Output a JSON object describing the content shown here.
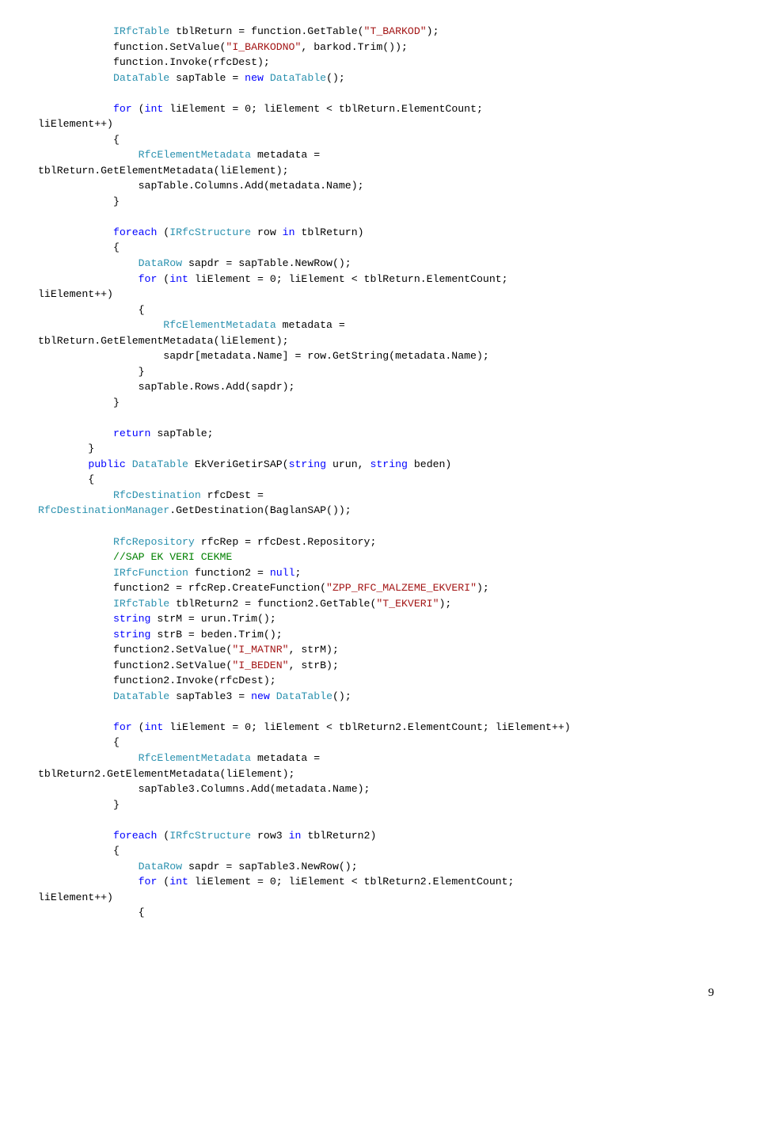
{
  "page_number": "9",
  "tokens": {
    "kw_for": "for",
    "kw_int": "int",
    "kw_new": "new",
    "kw_foreach": "foreach",
    "kw_in": "in",
    "kw_return": "return",
    "kw_public": "public",
    "kw_string": "string",
    "kw_null": "null",
    "type_IRfcTable": "IRfcTable",
    "type_DataTable": "DataTable",
    "type_RfcElementMetadata": "RfcElementMetadata",
    "type_IRfcStructure": "IRfcStructure",
    "type_DataRow": "DataRow",
    "type_RfcDestination": "RfcDestination",
    "type_RfcDestinationManager": "RfcDestinationManager",
    "type_RfcRepository": "RfcRepository",
    "type_IRfcFunction": "IRfcFunction",
    "str_T_BARKOD": "\"T_BARKOD\"",
    "str_I_BARKODNO": "\"I_BARKODNO\"",
    "str_ZPP": "\"ZPP_RFC_MALZEME_EKVERI\"",
    "str_T_EKVERI": "\"T_EKVERI\"",
    "str_I_MATNR": "\"I_MATNR\"",
    "str_I_BEDEN": "\"I_BEDEN\"",
    "com_sap": "//SAP EK VERI CEKME",
    "txt_line1": " tblReturn = function.GetTable(",
    "txt_line1b": ");",
    "txt_line2": "            function.SetValue(",
    "txt_line2b": ", barkod.Trim());",
    "txt_line3": "            function.Invoke(rfcDest);",
    "txt_line4a": " sapTable = ",
    "txt_line4b": "();",
    "txt_for1": " liElement = 0; liElement < tblReturn.ElementCount; ",
    "txt_liInc": "liElement++)",
    "txt_metadata_eq": " metadata = ",
    "txt_tblGet": "tblReturn.GetElementMetadata(liElement);",
    "txt_colAdd": "                sapTable.Columns.Add(metadata.Name);",
    "txt_rowIn": " row ",
    "txt_tblReturnParen": " tblReturn)",
    "txt_sapdrNew": " sapdr = sapTable.NewRow();",
    "txt_sapdrAssign": "                    sapdr[metadata.Name] = row.GetString(metadata.Name);",
    "txt_rowsAdd": "                sapTable.Rows.Add(sapdr);",
    "txt_returnSap": " sapTable;",
    "txt_methodSig1": " EkVeriGetirSAP(",
    "txt_methodSig2": " urun, ",
    "txt_methodSig3": " beden)",
    "txt_rfcDestEq": " rfcDest = ",
    "txt_getDest": ".GetDestination(BaglanSAP());",
    "txt_rfcRepEq": " rfcRep = rfcDest.Repository;",
    "txt_func2Eq": " function2 = ",
    "txt_func2Create": "            function2 = rfcRep.CreateFunction(",
    "txt_tblRet2": " tblReturn2 = function2.GetTable(",
    "txt_strM": " strM = urun.Trim();",
    "txt_strB": " strB = beden.Trim();",
    "txt_setM": "            function2.SetValue(",
    "txt_setMend": ", strM);",
    "txt_setBend": ", strB);",
    "txt_invoke2": "            function2.Invoke(rfcDest);",
    "txt_sapTable3a": " sapTable3 = ",
    "txt_for2": " liElement = 0; liElement < tblReturn2.ElementCount; liElement++)",
    "txt_tbl2Get": "tblReturn2.GetElementMetadata(liElement);",
    "txt_col3Add": "                sapTable3.Columns.Add(metadata.Name);",
    "txt_row3In": " row3 ",
    "txt_tblReturn2Paren": " tblReturn2)",
    "txt_sapdr3New": " sapdr = sapTable3.NewRow();",
    "txt_for3": " liElement = 0; liElement < tblReturn2.ElementCount; "
  },
  "chart_data": {
    "type": "none"
  }
}
